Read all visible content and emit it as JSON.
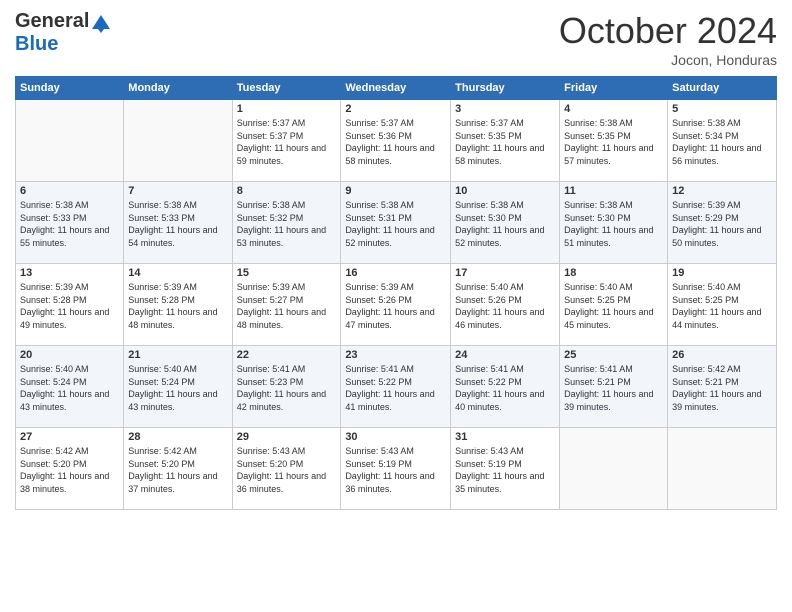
{
  "header": {
    "logo_general": "General",
    "logo_blue": "Blue",
    "month_title": "October 2024",
    "subtitle": "Jocon, Honduras"
  },
  "days_of_week": [
    "Sunday",
    "Monday",
    "Tuesday",
    "Wednesday",
    "Thursday",
    "Friday",
    "Saturday"
  ],
  "weeks": [
    [
      {
        "day": "",
        "sunrise": "",
        "sunset": "",
        "daylight": ""
      },
      {
        "day": "",
        "sunrise": "",
        "sunset": "",
        "daylight": ""
      },
      {
        "day": "1",
        "sunrise": "Sunrise: 5:37 AM",
        "sunset": "Sunset: 5:37 PM",
        "daylight": "Daylight: 11 hours and 59 minutes."
      },
      {
        "day": "2",
        "sunrise": "Sunrise: 5:37 AM",
        "sunset": "Sunset: 5:36 PM",
        "daylight": "Daylight: 11 hours and 58 minutes."
      },
      {
        "day": "3",
        "sunrise": "Sunrise: 5:37 AM",
        "sunset": "Sunset: 5:35 PM",
        "daylight": "Daylight: 11 hours and 58 minutes."
      },
      {
        "day": "4",
        "sunrise": "Sunrise: 5:38 AM",
        "sunset": "Sunset: 5:35 PM",
        "daylight": "Daylight: 11 hours and 57 minutes."
      },
      {
        "day": "5",
        "sunrise": "Sunrise: 5:38 AM",
        "sunset": "Sunset: 5:34 PM",
        "daylight": "Daylight: 11 hours and 56 minutes."
      }
    ],
    [
      {
        "day": "6",
        "sunrise": "Sunrise: 5:38 AM",
        "sunset": "Sunset: 5:33 PM",
        "daylight": "Daylight: 11 hours and 55 minutes."
      },
      {
        "day": "7",
        "sunrise": "Sunrise: 5:38 AM",
        "sunset": "Sunset: 5:33 PM",
        "daylight": "Daylight: 11 hours and 54 minutes."
      },
      {
        "day": "8",
        "sunrise": "Sunrise: 5:38 AM",
        "sunset": "Sunset: 5:32 PM",
        "daylight": "Daylight: 11 hours and 53 minutes."
      },
      {
        "day": "9",
        "sunrise": "Sunrise: 5:38 AM",
        "sunset": "Sunset: 5:31 PM",
        "daylight": "Daylight: 11 hours and 52 minutes."
      },
      {
        "day": "10",
        "sunrise": "Sunrise: 5:38 AM",
        "sunset": "Sunset: 5:30 PM",
        "daylight": "Daylight: 11 hours and 52 minutes."
      },
      {
        "day": "11",
        "sunrise": "Sunrise: 5:38 AM",
        "sunset": "Sunset: 5:30 PM",
        "daylight": "Daylight: 11 hours and 51 minutes."
      },
      {
        "day": "12",
        "sunrise": "Sunrise: 5:39 AM",
        "sunset": "Sunset: 5:29 PM",
        "daylight": "Daylight: 11 hours and 50 minutes."
      }
    ],
    [
      {
        "day": "13",
        "sunrise": "Sunrise: 5:39 AM",
        "sunset": "Sunset: 5:28 PM",
        "daylight": "Daylight: 11 hours and 49 minutes."
      },
      {
        "day": "14",
        "sunrise": "Sunrise: 5:39 AM",
        "sunset": "Sunset: 5:28 PM",
        "daylight": "Daylight: 11 hours and 48 minutes."
      },
      {
        "day": "15",
        "sunrise": "Sunrise: 5:39 AM",
        "sunset": "Sunset: 5:27 PM",
        "daylight": "Daylight: 11 hours and 48 minutes."
      },
      {
        "day": "16",
        "sunrise": "Sunrise: 5:39 AM",
        "sunset": "Sunset: 5:26 PM",
        "daylight": "Daylight: 11 hours and 47 minutes."
      },
      {
        "day": "17",
        "sunrise": "Sunrise: 5:40 AM",
        "sunset": "Sunset: 5:26 PM",
        "daylight": "Daylight: 11 hours and 46 minutes."
      },
      {
        "day": "18",
        "sunrise": "Sunrise: 5:40 AM",
        "sunset": "Sunset: 5:25 PM",
        "daylight": "Daylight: 11 hours and 45 minutes."
      },
      {
        "day": "19",
        "sunrise": "Sunrise: 5:40 AM",
        "sunset": "Sunset: 5:25 PM",
        "daylight": "Daylight: 11 hours and 44 minutes."
      }
    ],
    [
      {
        "day": "20",
        "sunrise": "Sunrise: 5:40 AM",
        "sunset": "Sunset: 5:24 PM",
        "daylight": "Daylight: 11 hours and 43 minutes."
      },
      {
        "day": "21",
        "sunrise": "Sunrise: 5:40 AM",
        "sunset": "Sunset: 5:24 PM",
        "daylight": "Daylight: 11 hours and 43 minutes."
      },
      {
        "day": "22",
        "sunrise": "Sunrise: 5:41 AM",
        "sunset": "Sunset: 5:23 PM",
        "daylight": "Daylight: 11 hours and 42 minutes."
      },
      {
        "day": "23",
        "sunrise": "Sunrise: 5:41 AM",
        "sunset": "Sunset: 5:22 PM",
        "daylight": "Daylight: 11 hours and 41 minutes."
      },
      {
        "day": "24",
        "sunrise": "Sunrise: 5:41 AM",
        "sunset": "Sunset: 5:22 PM",
        "daylight": "Daylight: 11 hours and 40 minutes."
      },
      {
        "day": "25",
        "sunrise": "Sunrise: 5:41 AM",
        "sunset": "Sunset: 5:21 PM",
        "daylight": "Daylight: 11 hours and 39 minutes."
      },
      {
        "day": "26",
        "sunrise": "Sunrise: 5:42 AM",
        "sunset": "Sunset: 5:21 PM",
        "daylight": "Daylight: 11 hours and 39 minutes."
      }
    ],
    [
      {
        "day": "27",
        "sunrise": "Sunrise: 5:42 AM",
        "sunset": "Sunset: 5:20 PM",
        "daylight": "Daylight: 11 hours and 38 minutes."
      },
      {
        "day": "28",
        "sunrise": "Sunrise: 5:42 AM",
        "sunset": "Sunset: 5:20 PM",
        "daylight": "Daylight: 11 hours and 37 minutes."
      },
      {
        "day": "29",
        "sunrise": "Sunrise: 5:43 AM",
        "sunset": "Sunset: 5:20 PM",
        "daylight": "Daylight: 11 hours and 36 minutes."
      },
      {
        "day": "30",
        "sunrise": "Sunrise: 5:43 AM",
        "sunset": "Sunset: 5:19 PM",
        "daylight": "Daylight: 11 hours and 36 minutes."
      },
      {
        "day": "31",
        "sunrise": "Sunrise: 5:43 AM",
        "sunset": "Sunset: 5:19 PM",
        "daylight": "Daylight: 11 hours and 35 minutes."
      },
      {
        "day": "",
        "sunrise": "",
        "sunset": "",
        "daylight": ""
      },
      {
        "day": "",
        "sunrise": "",
        "sunset": "",
        "daylight": ""
      }
    ]
  ]
}
